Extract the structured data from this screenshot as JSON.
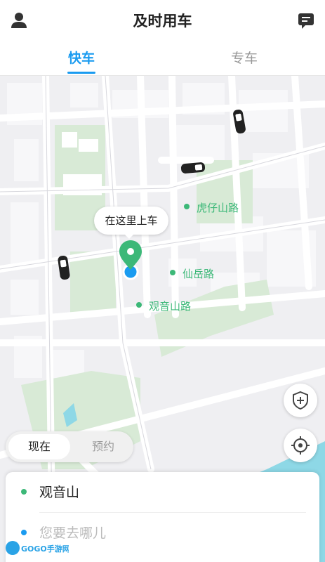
{
  "header": {
    "title": "及时用车",
    "left_icon": "user-icon",
    "right_icon": "message-icon"
  },
  "tabs": [
    {
      "label": "快车",
      "active": true
    },
    {
      "label": "专车",
      "active": false
    }
  ],
  "map": {
    "pickup_bubble": "在这里上车",
    "road_labels": [
      "虎仔山路",
      "仙岳路",
      "观音山路"
    ]
  },
  "time_toggle": {
    "now_label": "现在",
    "book_label": "预约",
    "selected": "现在"
  },
  "address": {
    "start": "观音山",
    "destination_placeholder": "您要去哪儿"
  },
  "watermark": {
    "text": "GOGO手游网"
  },
  "colors": {
    "accent": "#1a9bf0",
    "green": "#3cb878",
    "water": "#8ed8e6",
    "park": "#d8ead6"
  }
}
